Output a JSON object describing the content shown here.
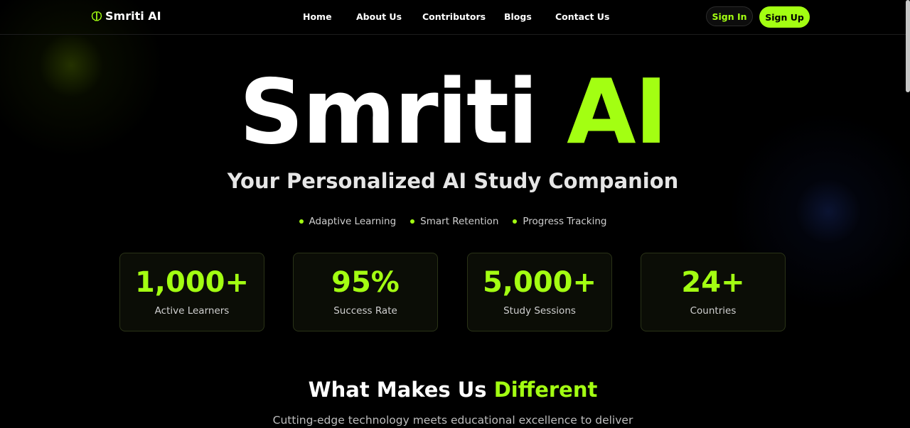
{
  "header": {
    "logo": {
      "icon": "brain-icon",
      "text": "Smriti AI"
    },
    "nav": [
      "Home",
      "About Us",
      "Contributors",
      "Blogs",
      "Contact Us"
    ],
    "sign_in": "Sign In",
    "sign_up": "Sign Up"
  },
  "hero": {
    "title_part1": "Smriti",
    "title_part2": "AI",
    "subtitle": "Your Personalized AI Study Companion",
    "features": [
      "Adaptive Learning",
      "Smart Retention",
      "Progress Tracking"
    ]
  },
  "stats": [
    {
      "value": "1,000+",
      "label": "Active Learners"
    },
    {
      "value": "95%",
      "label": "Success Rate"
    },
    {
      "value": "5,000+",
      "label": "Study Sessions"
    },
    {
      "value": "24+",
      "label": "Countries"
    }
  ],
  "section": {
    "title_part1": "What Makes Us",
    "title_part2": "Different",
    "description": "Cutting-edge technology meets educational excellence to deliver"
  },
  "colors": {
    "accent": "#a3ff12",
    "background": "#000000"
  }
}
